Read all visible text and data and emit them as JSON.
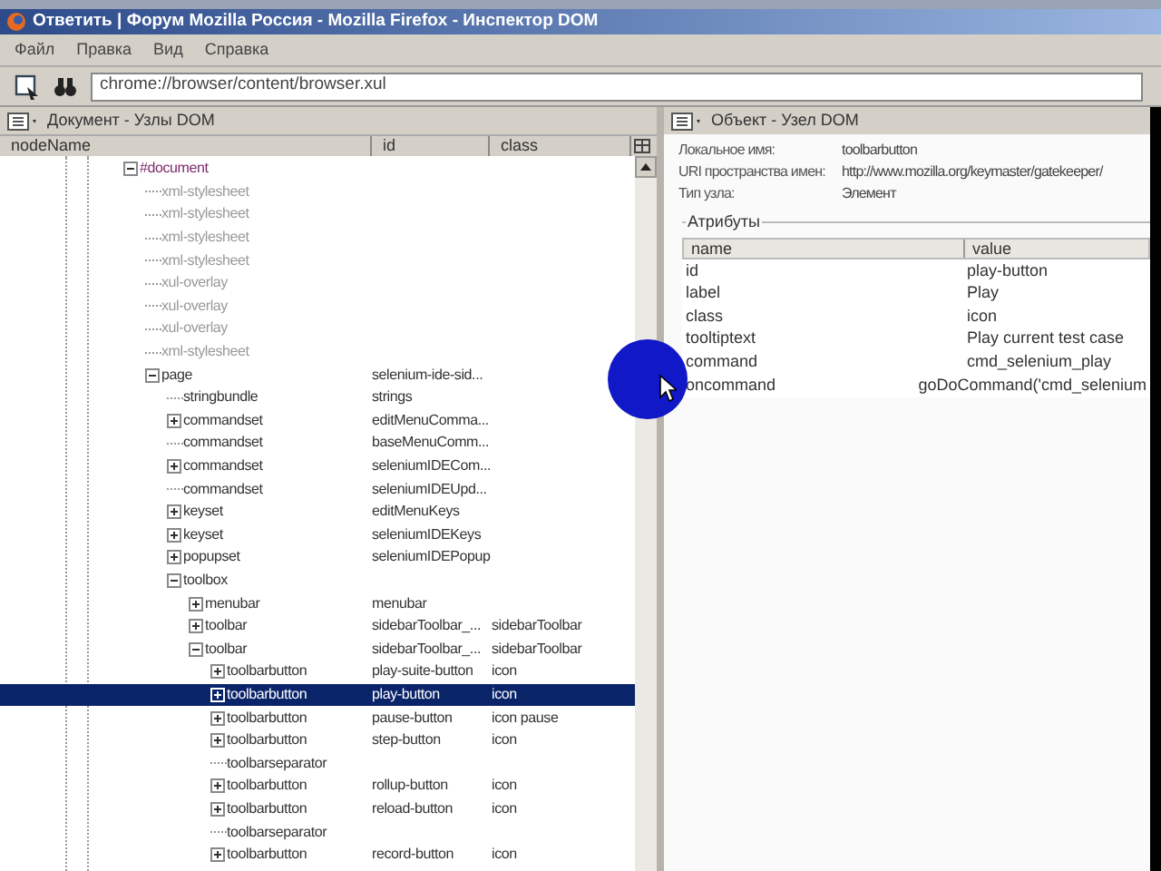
{
  "window": {
    "title": "Ответить | Форум Mozilla Россия - Mozilla Firefox - Инспектор DOM"
  },
  "menu": [
    "Файл",
    "Правка",
    "Вид",
    "Справка"
  ],
  "toolbar": {
    "url": "chrome://browser/content/browser.xul"
  },
  "left_panel": {
    "title": "Документ - Узлы DOM",
    "columns": [
      "nodeName",
      "id",
      "class"
    ],
    "tree": [
      {
        "name": "#document",
        "kind": "document",
        "expanded": true,
        "selected": false,
        "children": [
          {
            "name": "xml-stylesheet",
            "kind": "pi",
            "selected": false
          },
          {
            "name": "xml-stylesheet",
            "kind": "pi",
            "selected": false
          },
          {
            "name": "xml-stylesheet",
            "kind": "pi",
            "selected": false
          },
          {
            "name": "xml-stylesheet",
            "kind": "pi",
            "selected": false
          },
          {
            "name": "xul-overlay",
            "kind": "pi",
            "selected": false
          },
          {
            "name": "xul-overlay",
            "kind": "pi",
            "selected": false
          },
          {
            "name": "xul-overlay",
            "kind": "pi",
            "selected": false
          },
          {
            "name": "xml-stylesheet",
            "kind": "pi",
            "selected": false
          },
          {
            "name": "page",
            "id": "selenium-ide-sid...",
            "kind": "element",
            "expanded": true,
            "selected": false,
            "children": [
              {
                "name": "stringbundle",
                "id": "strings",
                "kind": "element",
                "selected": false
              },
              {
                "name": "commandset",
                "id": "editMenuComma...",
                "kind": "element",
                "expanded": false,
                "selected": false
              },
              {
                "name": "commandset",
                "id": "baseMenuComm...",
                "kind": "element",
                "selected": false
              },
              {
                "name": "commandset",
                "id": "seleniumIDECom...",
                "kind": "element",
                "expanded": false,
                "selected": false
              },
              {
                "name": "commandset",
                "id": "seleniumIDEUpd...",
                "kind": "element",
                "selected": false
              },
              {
                "name": "keyset",
                "id": "editMenuKeys",
                "kind": "element",
                "expanded": false,
                "selected": false
              },
              {
                "name": "keyset",
                "id": "seleniumIDEKeys",
                "kind": "element",
                "expanded": false,
                "selected": false
              },
              {
                "name": "popupset",
                "id": "seleniumIDEPopup",
                "kind": "element",
                "expanded": false,
                "selected": false
              },
              {
                "name": "toolbox",
                "kind": "element",
                "expanded": true,
                "selected": false,
                "children": [
                  {
                    "name": "menubar",
                    "id": "menubar",
                    "kind": "element",
                    "expanded": false,
                    "selected": false
                  },
                  {
                    "name": "toolbar",
                    "id": "sidebarToolbar_...",
                    "class": "sidebarToolbar",
                    "kind": "element",
                    "expanded": false,
                    "selected": false
                  },
                  {
                    "name": "toolbar",
                    "id": "sidebarToolbar_...",
                    "class": "sidebarToolbar",
                    "kind": "element",
                    "expanded": true,
                    "selected": false,
                    "children": [
                      {
                        "name": "toolbarbutton",
                        "id": "play-suite-button",
                        "class": "icon",
                        "kind": "element",
                        "expanded": false,
                        "selected": false
                      },
                      {
                        "name": "toolbarbutton",
                        "id": "play-button",
                        "class": "icon",
                        "kind": "element",
                        "expanded": false,
                        "selected": true
                      },
                      {
                        "name": "toolbarbutton",
                        "id": "pause-button",
                        "class": "icon pause",
                        "kind": "element",
                        "expanded": false,
                        "selected": false
                      },
                      {
                        "name": "toolbarbutton",
                        "id": "step-button",
                        "class": "icon",
                        "kind": "element",
                        "expanded": false,
                        "selected": false
                      },
                      {
                        "name": "toolbarseparator",
                        "kind": "element",
                        "selected": false
                      },
                      {
                        "name": "toolbarbutton",
                        "id": "rollup-button",
                        "class": "icon",
                        "kind": "element",
                        "expanded": false,
                        "selected": false
                      },
                      {
                        "name": "toolbarbutton",
                        "id": "reload-button",
                        "class": "icon",
                        "kind": "element",
                        "expanded": false,
                        "selected": false
                      },
                      {
                        "name": "toolbarseparator",
                        "kind": "element",
                        "selected": false
                      },
                      {
                        "name": "toolbarbutton",
                        "id": "record-button",
                        "class": "icon",
                        "kind": "element",
                        "expanded": false,
                        "selected": false
                      }
                    ]
                  }
                ]
              }
            ]
          }
        ]
      }
    ]
  },
  "right_panel": {
    "title": "Объект - Узел DOM",
    "properties": [
      {
        "label": "Локальное имя:",
        "value": "toolbarbutton"
      },
      {
        "label": "URI пространства имен:",
        "value": "http://www.mozilla.org/keymaster/gatekeeper/"
      },
      {
        "label": "Тип узла:",
        "value": "Элемент"
      }
    ],
    "attributes": {
      "title": "Атрибуты",
      "columns": [
        "name",
        "value"
      ],
      "rows": [
        {
          "name": "id",
          "value": "play-button"
        },
        {
          "name": "label",
          "value": "Play"
        },
        {
          "name": "class",
          "value": "icon"
        },
        {
          "name": "tooltiptext",
          "value": "Play current test case"
        },
        {
          "name": "command",
          "value": "cmd_selenium_play"
        },
        {
          "name": "oncommand",
          "value": "goDoCommand('cmd_selenium"
        }
      ]
    }
  }
}
